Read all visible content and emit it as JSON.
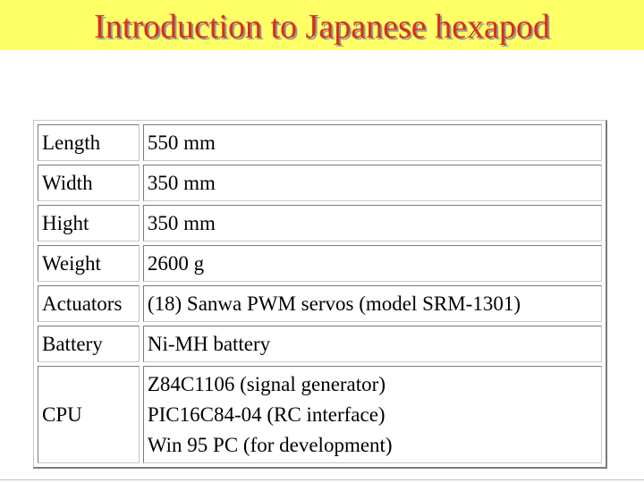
{
  "slide": {
    "title": "Introduction to Japanese hexapod"
  },
  "specs": [
    {
      "label": "Length",
      "value": [
        "550 mm"
      ]
    },
    {
      "label": "Width",
      "value": [
        "350 mm"
      ]
    },
    {
      "label": "Hight",
      "value": [
        "350 mm"
      ]
    },
    {
      "label": "Weight",
      "value": [
        "2600 g"
      ]
    },
    {
      "label": "Actuators",
      "value": [
        "(18) Sanwa PWM servos (model SRM-1301)"
      ]
    },
    {
      "label": "Battery",
      "value": [
        "Ni-MH battery"
      ]
    },
    {
      "label": "CPU",
      "value": [
        "Z84C1106 (signal generator)",
        "PIC16C84-04 (RC interface)",
        "Win 95 PC (for development)"
      ]
    }
  ],
  "colors": {
    "title_bar": "#ffff66",
    "title_text": "#d83018"
  }
}
